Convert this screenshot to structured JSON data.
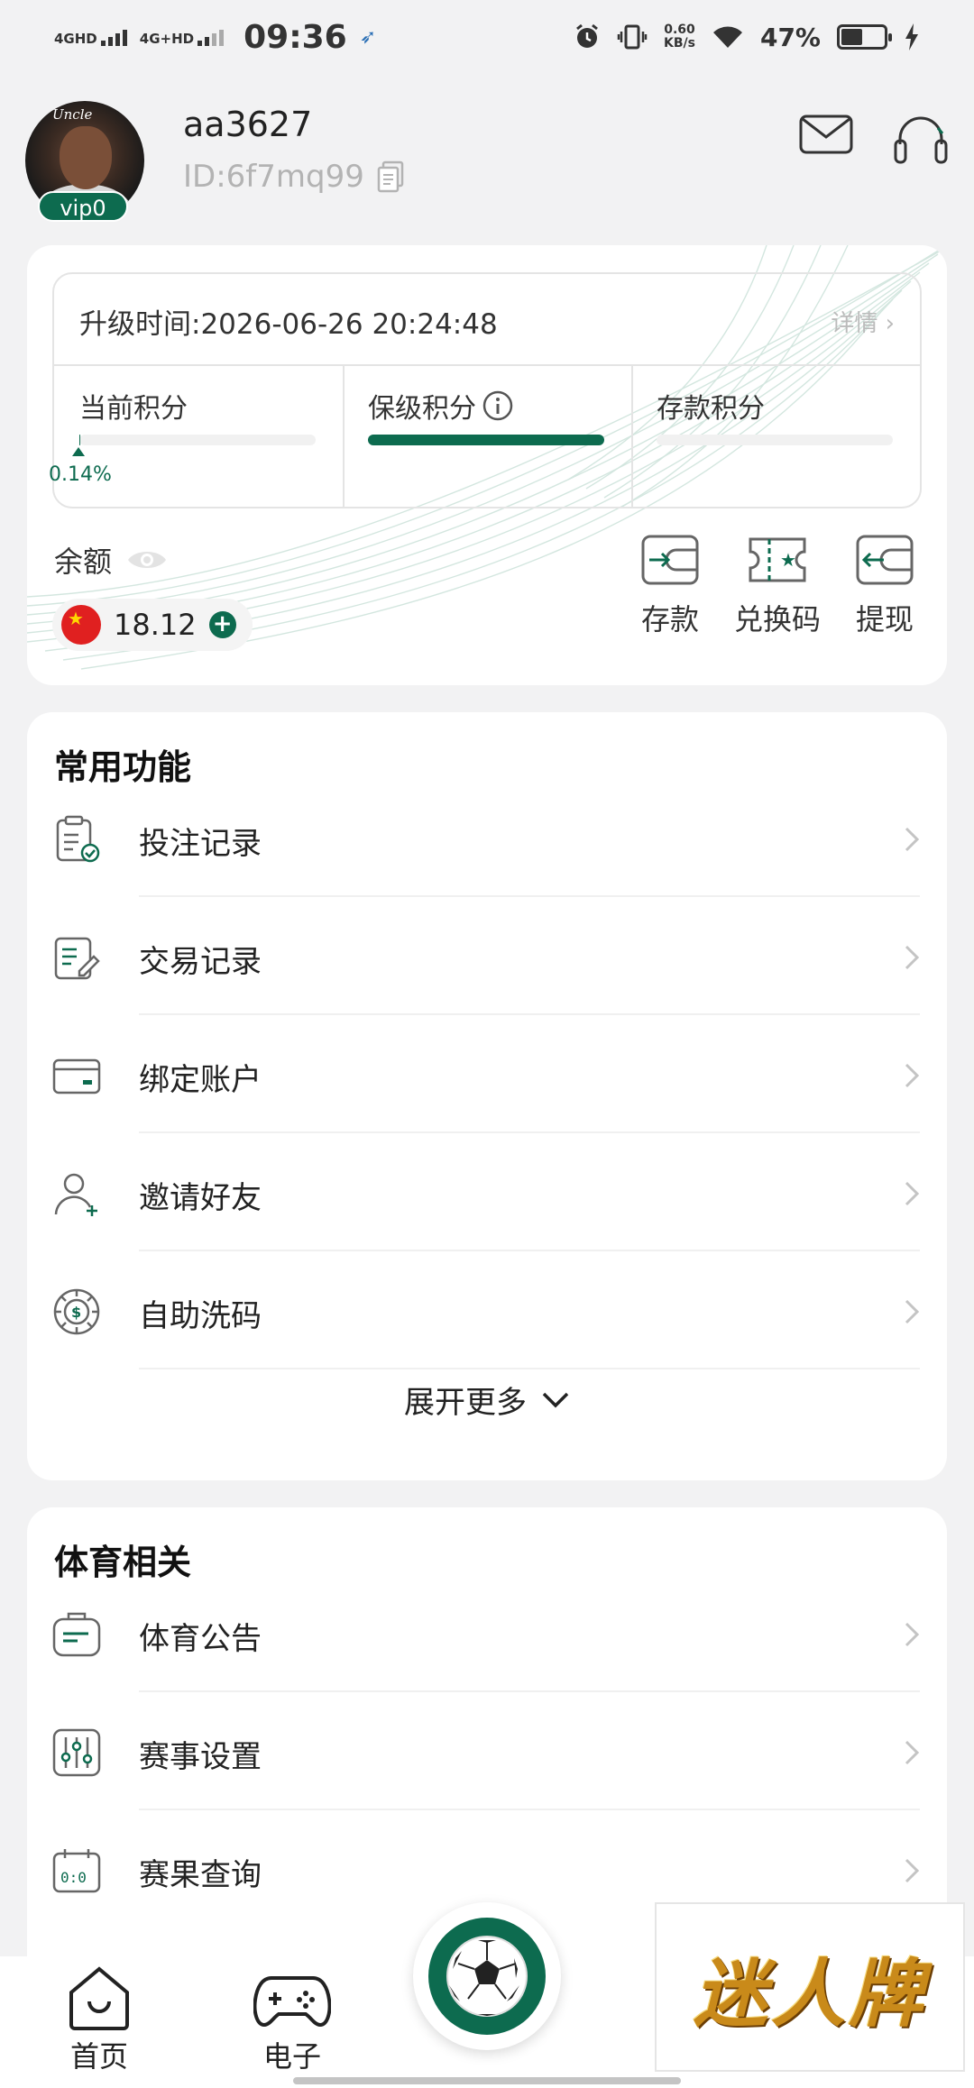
{
  "status_bar": {
    "net1": "4GHD",
    "net2": "4G+HD",
    "time": "09:36",
    "speed_value": "0.60",
    "speed_unit": "KB/s",
    "battery": "47%"
  },
  "profile": {
    "username": "aa3627",
    "user_id": "ID:6f7mq99",
    "vip_level": "vip0",
    "avatar_caption": "Uncle"
  },
  "level": {
    "upgrade_time": "升级时间:2026-06-26 20:24:48",
    "detail_label": "详情",
    "current_points_label": "当前积分",
    "current_points_percent": "0.14%",
    "current_points_fraction": 0.0014,
    "keep_points_label": "保级积分",
    "keep_points_fraction": 1.0,
    "deposit_points_label": "存款积分",
    "deposit_points_fraction": 0
  },
  "balance": {
    "label": "余额",
    "amount": "18.12",
    "actions": [
      {
        "label": "存款",
        "icon": "deposit-wallet-icon"
      },
      {
        "label": "兑换码",
        "icon": "redeem-ticket-icon"
      },
      {
        "label": "提现",
        "icon": "withdraw-wallet-icon"
      }
    ]
  },
  "common": {
    "title": "常用功能",
    "items": [
      {
        "label": "投注记录",
        "icon": "bet-record-icon"
      },
      {
        "label": "交易记录",
        "icon": "transaction-record-icon"
      },
      {
        "label": "绑定账户",
        "icon": "card-icon"
      },
      {
        "label": "邀请好友",
        "icon": "invite-user-icon"
      },
      {
        "label": "自助洗码",
        "icon": "chip-icon"
      }
    ],
    "expand_label": "展开更多"
  },
  "sports": {
    "title": "体育相关",
    "items": [
      {
        "label": "体育公告",
        "icon": "announcement-icon"
      },
      {
        "label": "赛事设置",
        "icon": "settings-sliders-icon"
      },
      {
        "label": "赛果查询",
        "icon": "score-calendar-icon"
      }
    ]
  },
  "nav": {
    "home": "首页",
    "electronic": "电子"
  },
  "watermark": "迷人牌",
  "colors": {
    "brand_green": "#0d6b4f",
    "background": "#f2f2f3",
    "card": "#ffffff"
  }
}
